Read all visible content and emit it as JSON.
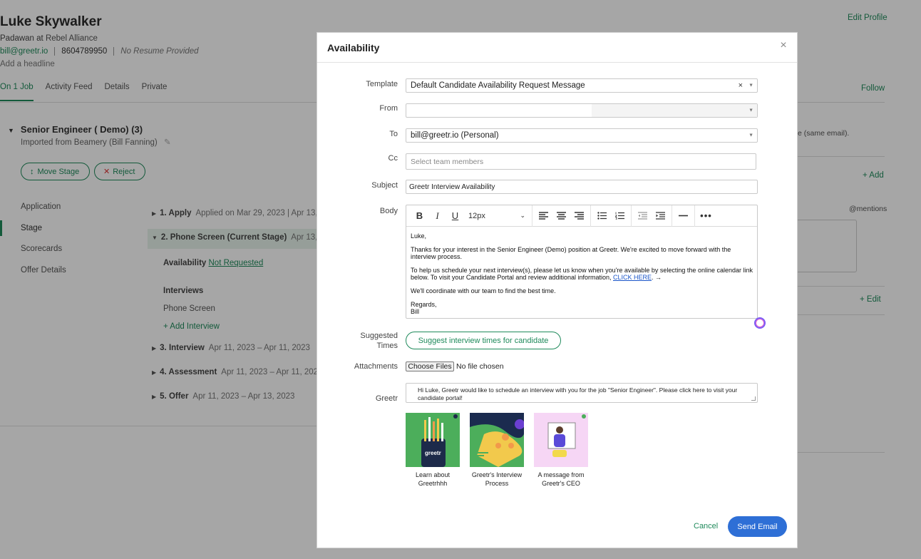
{
  "profile": {
    "name": "Luke Skywalker",
    "role_title": "Padawan",
    "role_at": " at ",
    "company": "Rebel Alliance",
    "email": "bill@greetr.io",
    "phone": "8604789950",
    "resume": "No Resume Provided",
    "headline": "Add a headline",
    "edit_profile": "Edit Profile",
    "follow": "Follow"
  },
  "tabs": [
    "On 1 Job",
    "Activity Feed",
    "Details",
    "Private"
  ],
  "job": {
    "title": "Senior Engineer ( Demo) (3)",
    "imported": "Imported from Beamery (Bill Fanning)",
    "move_stage": "Move Stage",
    "reject": "Reject"
  },
  "left_nav": [
    "Application",
    "Stage",
    "Scorecards",
    "Offer Details"
  ],
  "stages": [
    {
      "label": "1.  Apply",
      "date": "Applied on Mar 29, 2023 | Apr 13,"
    },
    {
      "label": "2.  Phone Screen (Current Stage)",
      "date": "Apr 13, 2"
    },
    {
      "label": "3.  Interview",
      "date": "Apr 11, 2023 – Apr 11, 2023"
    },
    {
      "label": "4.  Assessment",
      "date": "Apr 11, 2023 – Apr 11, 2023"
    },
    {
      "label": "5.  Offer",
      "date": "Apr 11, 2023 – Apr 13, 2023"
    }
  ],
  "availability": {
    "label": "Availability",
    "status": "Not Requested"
  },
  "interviews": {
    "heading": "Interviews",
    "item": "Phone Screen",
    "add": "+ Add Interview"
  },
  "right_panel": {
    "same_email": "e (same email).",
    "add": "+ Add",
    "mentions": "@mentions",
    "edit": "+ Edit"
  },
  "modal": {
    "title": "Availability",
    "labels": {
      "template": "Template",
      "from": "From",
      "to": "To",
      "cc": "Cc",
      "subject": "Subject",
      "body": "Body",
      "suggested": "Suggested",
      "times": "Times",
      "attachments": "Attachments",
      "greetr": "Greetr"
    },
    "template_value": "Default Candidate Availability Request Message",
    "template_clear": "×",
    "from_value": "",
    "to_value": "bill@greetr.io (Personal)",
    "cc_placeholder": "Select team members",
    "subject_value": "Greetr Interview Availability",
    "font_size": "12px",
    "body": {
      "greeting": "Luke,",
      "p1": "Thanks for your interest in the Senior Engineer (Demo) position at Greetr. We're excited to move forward with the interview process.",
      "p2": "To help us schedule your next interview(s), please let us know when you're available by selecting the online calendar link below.  To visit your Candidate Portal and review additional information, ",
      "p2_link": "CLICK HERE",
      "p2_end": ". →",
      "p3": "We'll coordinate with our team to find the best time.",
      "regards": "Regards,",
      "sign": "Bill"
    },
    "suggest_button": "Suggest interview times for candidate",
    "choose_files": "Choose Files",
    "no_file": "No file chosen",
    "greetr_message": "Hi Luke, Greetr would like to schedule an interview with you for the job \"Senior Engineer\".  Please click here to visit your candidate portal!",
    "cards": [
      {
        "caption_1": "Learn about",
        "caption_2": "Greetrhhh",
        "brand": "greetr"
      },
      {
        "caption_1": "Greetr's Interview",
        "caption_2": "Process"
      },
      {
        "caption_1": "A message from",
        "caption_2": "Greetr's CEO"
      }
    ],
    "cancel": "Cancel",
    "send": "Send Email"
  }
}
